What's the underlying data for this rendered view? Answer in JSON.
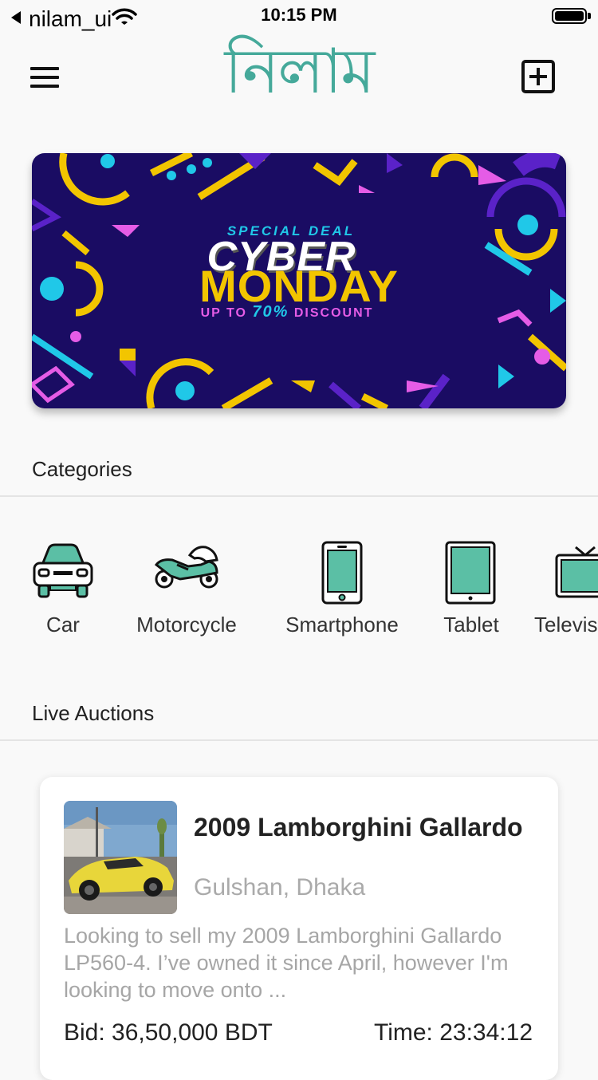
{
  "status_bar": {
    "back_app": "nilam_ui",
    "time": "10:15 PM"
  },
  "header": {
    "logo_text": "নিলাম",
    "logo_color": "#45a99a",
    "menu_icon": "hamburger-menu-icon",
    "add_icon": "plus-square-icon"
  },
  "banner": {
    "special": "SPECIAL DEAL",
    "line1": "CYBER",
    "line2": "MONDAY",
    "discount_prefix": "UP TO",
    "discount_value": "70%",
    "discount_suffix": "DISCOUNT",
    "background": "#1a0c63"
  },
  "sections": {
    "categories_title": "Categories",
    "live_auctions_title": "Live Auctions"
  },
  "categories": [
    {
      "label": "Car",
      "icon": "car-icon"
    },
    {
      "label": "Motorcycle",
      "icon": "motorcycle-icon"
    },
    {
      "label": "Smartphone",
      "icon": "smartphone-icon"
    },
    {
      "label": "Tablet",
      "icon": "tablet-icon"
    },
    {
      "label": "Televis",
      "icon": "television-icon"
    }
  ],
  "accent_color": "#5bbfa5",
  "auction": {
    "title": "2009 Lamborghini Gallardo",
    "location": "Gulshan, Dhaka",
    "description": "Looking to sell my 2009 Lamborghini Gallardo LP560-4. I’ve owned it since April, however I'm looking to move onto ...",
    "bid": "Bid: 36,50,000 BDT",
    "time": "Time: 23:34:12"
  }
}
